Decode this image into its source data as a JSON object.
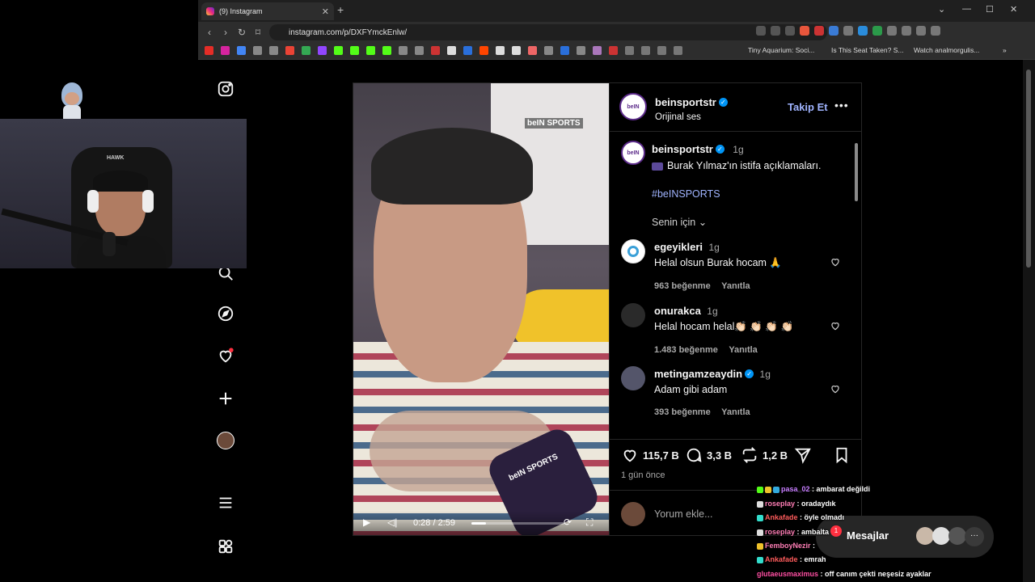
{
  "browser": {
    "tab_title": "(9) Instagram",
    "url": "instagram.com/p/DXFYmckEnlw/",
    "bookmarks": [
      "Tiny Aquarium: Soci...",
      "Is This Seat Taken? S...",
      "Watch analmorgulis..."
    ]
  },
  "post": {
    "author": "beinsportstr",
    "audio": "Orijinal ses",
    "follow_label": "Takip Et",
    "caption_author": "beinsportstr",
    "caption_age": "1g",
    "caption": "Burak Yılmaz'ın istifa açıklamaları.",
    "hashtag": "#beINSPORTS",
    "filter_label": "Senin için",
    "video_time": "0:28 / 2:59",
    "video_progress": 0.16,
    "likes": "115,7 B",
    "comments_count": "3,3 B",
    "reposts": "1,2 B",
    "posted_ago": "1 gün önce",
    "comment_placeholder": "Yorum ekle..."
  },
  "comments": [
    {
      "user": "egeyikleri",
      "age": "1g",
      "text": "Helal olsun Burak hocam 🙏",
      "likes": "963 beğenme",
      "reply": "Yanıtla"
    },
    {
      "user": "onurakca",
      "age": "1g",
      "text": "Helal hocam helal👏🏻 👏🏻 👏🏻 👏🏻",
      "likes": "1.483 beğenme",
      "reply": "Yanıtla"
    },
    {
      "user": "metingamzeaydin",
      "age": "1g",
      "text": "Adam gibi adam",
      "likes": "393 beğenme",
      "reply": "Yanıtla",
      "verified": true
    }
  ],
  "messages": {
    "label": "Mesajlar",
    "badge": "1"
  },
  "chat": [
    {
      "user": "pasa_02",
      "text": ": ambarat değildi",
      "color": "#c77dff"
    },
    {
      "user": "roseplay",
      "text": ": oradaydık",
      "color": "#ff7eb6"
    },
    {
      "user": "Ankafade",
      "text": ": öyle olmadı",
      "color": "#ff5c5c"
    },
    {
      "user": "roseplay",
      "text": ": ambalta",
      "color": "#ff7eb6"
    },
    {
      "user": "FemboyNezir",
      "text": ":",
      "color": "#ff7eb6"
    },
    {
      "user": "Ankafade",
      "text": ": emrah",
      "color": "#ff5c5c"
    },
    {
      "user": "glutaeusmaximus",
      "text": ": off canım çekti neşesiz ayaklar",
      "color": "#ff4fa3"
    }
  ],
  "webcam": {
    "chair_brand": "HAWK"
  },
  "video": {
    "overlay_brand": "beIN SPORTS",
    "mic_brand": "beIN SPORTS"
  },
  "colors": {
    "accent_link": "#a0b4ff",
    "verified": "#0095f6",
    "notify": "#ff3040"
  }
}
